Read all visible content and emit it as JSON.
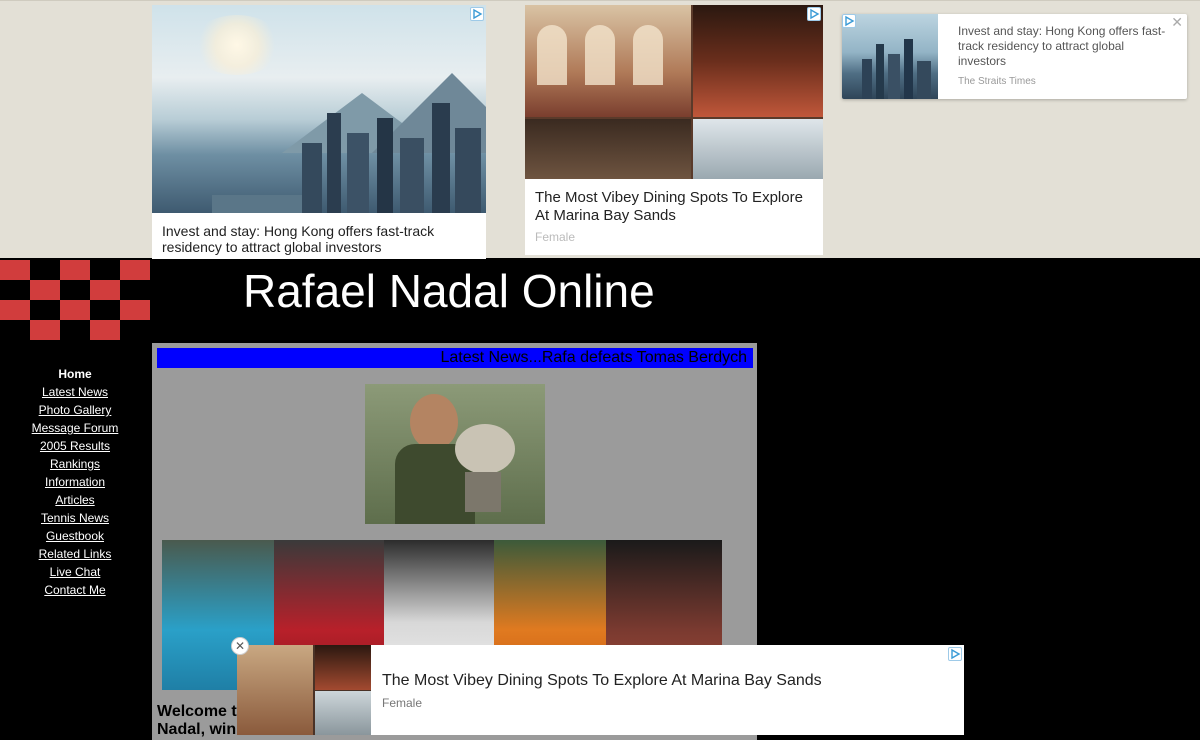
{
  "ads": {
    "top_left": {
      "title": "Invest and stay: Hong Kong offers fast-track residency to attract global investors"
    },
    "top_middle": {
      "title": "The Most Vibey Dining Spots To Explore At Marina Bay Sands",
      "source": "Female"
    },
    "top_right": {
      "title": "Invest and stay: Hong Kong offers fast-track residency to attract global investors",
      "source": "The Straits Times",
      "close": "✕"
    },
    "bottom": {
      "title": "The Most Vibey Dining Spots To Explore At Marina Bay Sands",
      "source": "Female",
      "close": "✕"
    }
  },
  "site": {
    "title": "Rafael Nadal Online",
    "ticker": "Latest News...Rafa defeats Tomas Berdych"
  },
  "nav": {
    "items": [
      {
        "label": "Home",
        "current": true
      },
      {
        "label": "Latest News"
      },
      {
        "label": "Photo Gallery"
      },
      {
        "label": "Message Forum"
      },
      {
        "label": "2005 Results"
      },
      {
        "label": "Rankings"
      },
      {
        "label": "Information"
      },
      {
        "label": "Articles"
      },
      {
        "label": "Tennis News"
      },
      {
        "label": "Guestbook"
      },
      {
        "label": "Related Links"
      },
      {
        "label": "Live Chat"
      },
      {
        "label": "Contact Me"
      }
    ]
  },
  "main": {
    "welcome_line1": "Welcome t",
    "welcome_line2": "Nadal, win"
  },
  "colors": {
    "checker_red": "#d13d3d",
    "ticker_bg": "#0000ff",
    "main_bg": "#9b9b9b",
    "ad_area_bg": "#e3e0d6"
  }
}
